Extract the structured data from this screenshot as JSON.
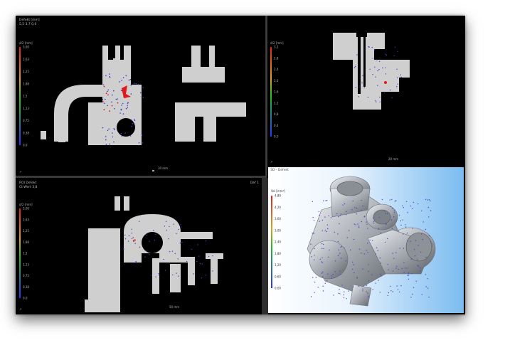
{
  "viewports": {
    "top_left": {
      "header_line1": "Defekt [mm]",
      "header_line2": "5,5 3,7 0,0",
      "legend_title": "d/2 [mm]",
      "legend_values": [
        "3,00",
        "2,63",
        "2,25",
        "1,88",
        "1,5",
        "1,13",
        "0,75",
        "0,38",
        "0,0"
      ],
      "scale_label": "30 mm"
    },
    "top_right": {
      "legend_title": "d/2 [mm]",
      "legend_values": [
        "3,2",
        "2,8",
        "2,4",
        "2,0",
        "1,6",
        "1,2",
        "0,8",
        "0,4",
        "0,0"
      ],
      "scale_label": "20 mm"
    },
    "bottom_left": {
      "header_line1": "ROI Defekt",
      "header_line2": "Ct-Wert 3,8",
      "corner_label": "Def 1",
      "legend_title": "d/2 [mm]",
      "legend_values": [
        "3,00",
        "2,63",
        "2,25",
        "1,88",
        "1,5",
        "1,13",
        "0,75",
        "0,38",
        "0,0"
      ],
      "scale_label": "50 mm"
    },
    "bottom_right": {
      "header": "3D - Defekt",
      "legend_title": "Vol [mm³]",
      "legend_values": [
        "4,80",
        "4,20",
        "3,60",
        "3,00",
        "2,40",
        "1,80",
        "1,20",
        "0,60",
        "0,00"
      ]
    }
  },
  "colors": {
    "part_gray": "#cfcfcf",
    "defect_blue": "#3a3ad0",
    "defect_red": "#e01818",
    "legend_top": "#e02020",
    "legend_mid": "#20c020",
    "legend_bottom": "#3030ff"
  }
}
